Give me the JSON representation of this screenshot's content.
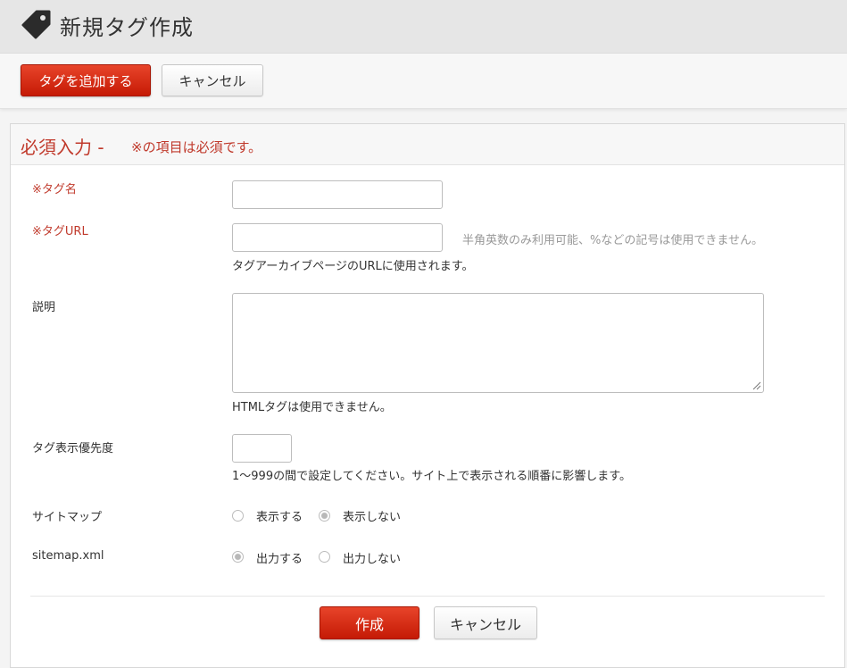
{
  "header": {
    "title": "新規タグ作成",
    "icon": "tag-icon"
  },
  "toolbar": {
    "add_label": "タグを追加する",
    "cancel_label": "キャンセル"
  },
  "form": {
    "section_title": "必須入力 -",
    "section_note": "※の項目は必須です。",
    "fields": {
      "tag_name": {
        "label": "※タグ名",
        "value": ""
      },
      "tag_url": {
        "label": "※タグURL",
        "value": "",
        "hint": "半角英数のみ利用可能、%などの記号は使用できません。",
        "note": "タグアーカイブページのURLに使用されます。"
      },
      "description": {
        "label": "説明",
        "value": "",
        "note": "HTMLタグは使用できません。"
      },
      "priority": {
        "label": "タグ表示優先度",
        "value": "",
        "note": "1～999の間で設定してください。サイト上で表示される順番に影響します。"
      },
      "sitemap": {
        "label": "サイトマップ",
        "options": [
          "表示する",
          "表示しない"
        ],
        "selected": "表示しない"
      },
      "sitemap_xml": {
        "label": "sitemap.xml",
        "options": [
          "出力する",
          "出力しない"
        ],
        "selected": "出力する"
      }
    },
    "submit_label": "作成",
    "cancel_label": "キャンセル"
  },
  "colors": {
    "accent_red": "#d12a10",
    "required_text": "#c0392b"
  }
}
